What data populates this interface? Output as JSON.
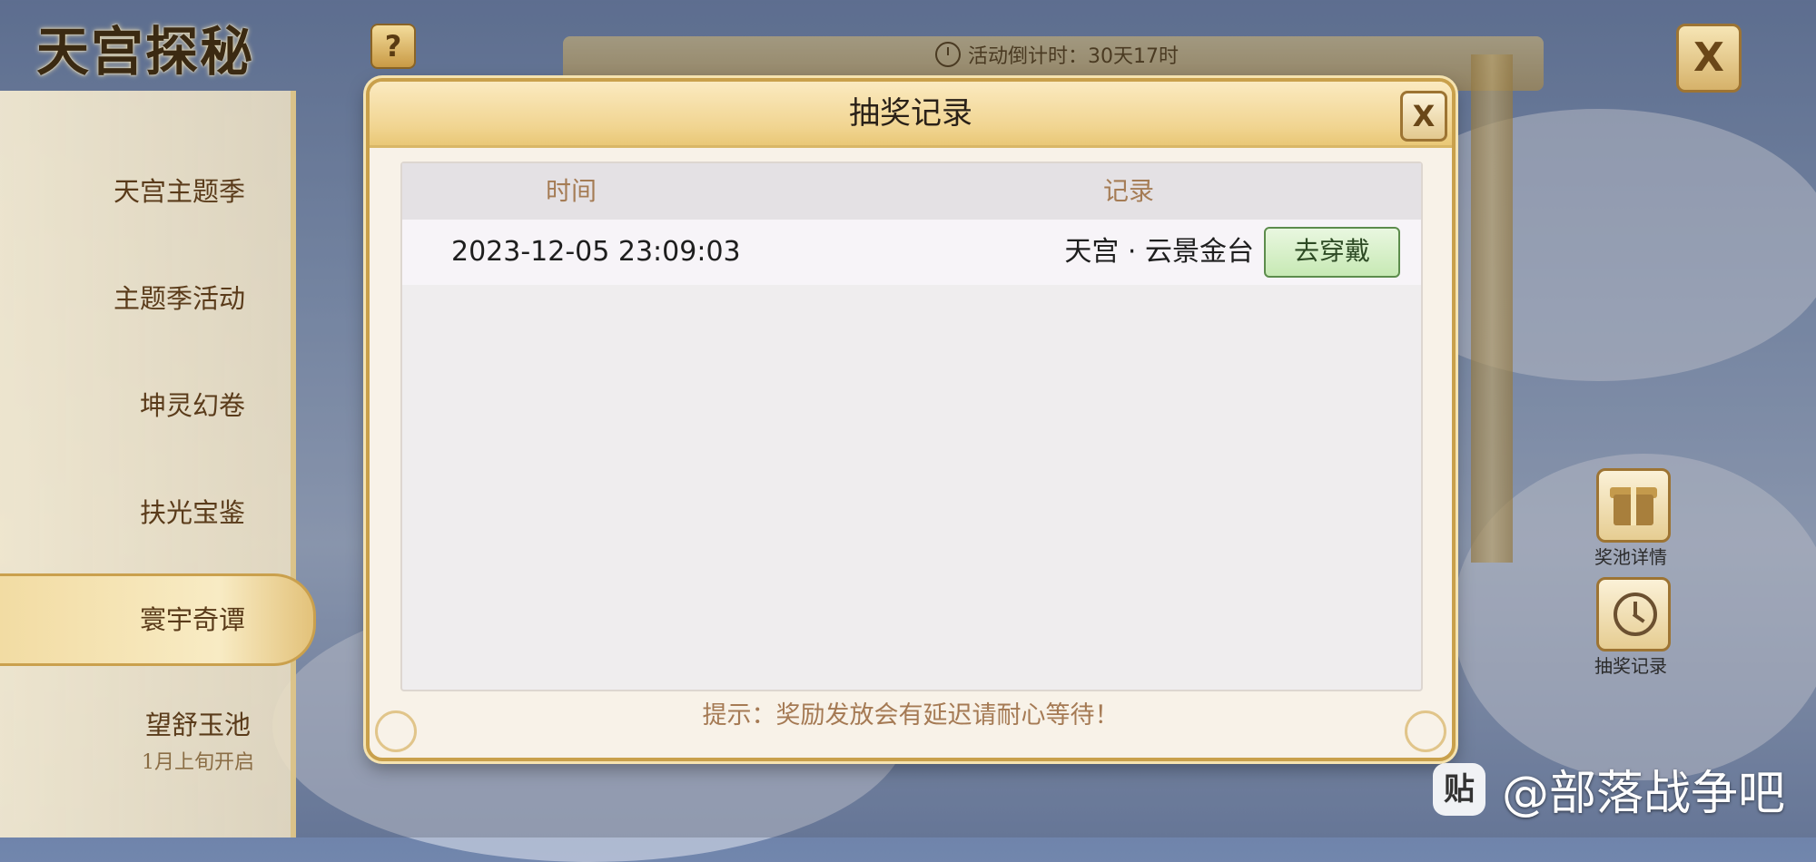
{
  "header": {
    "logo_text": "天宫探秘",
    "help_label": "?",
    "countdown_text": "活动倒计时：30天17时",
    "close_label": "X"
  },
  "sidebar": {
    "items": [
      {
        "label": "天宫主题季",
        "sub": ""
      },
      {
        "label": "主题季活动",
        "sub": ""
      },
      {
        "label": "坤灵幻卷",
        "sub": ""
      },
      {
        "label": "扶光宝鉴",
        "sub": ""
      },
      {
        "label": "寰宇奇谭",
        "sub": ""
      },
      {
        "label": "望舒玉池",
        "sub": "1月上旬开启"
      }
    ],
    "active_index": 4
  },
  "right_buttons": {
    "pool_details": "奖池详情",
    "draw_records": "抽奖记录"
  },
  "modal": {
    "title": "抽奖记录",
    "close_label": "X",
    "columns": [
      "时间",
      "记录"
    ],
    "rows": [
      {
        "time": "2023-12-05 23:09:03",
        "record": "天宫 · 云景金台",
        "action": "去穿戴"
      }
    ],
    "tip": "提示：奖励发放会有延迟请耐心等待！"
  },
  "watermark": {
    "badge": "贴",
    "text": "@部落战争吧"
  }
}
